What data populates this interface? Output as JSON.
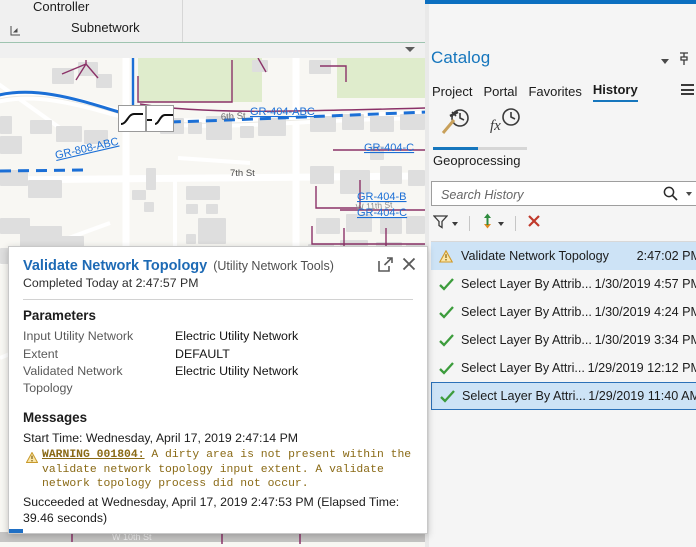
{
  "ribbon": {
    "group_labels": [
      "Controller",
      "Subnetwork"
    ],
    "dialog_launcher_icon": "dialog-launcher-icon"
  },
  "map": {
    "collapse_icon": "chevron-down-icon",
    "street_labels": [
      "6th St",
      "7th St",
      "W 10th St"
    ],
    "feature_labels": [
      "GR-808-ABC",
      "GR-404-ABC",
      "GR-404-C",
      "GR-404-B",
      "GR-404-C"
    ],
    "colors": {
      "land": "#f8f7f3",
      "park": "#dfeccc",
      "building": "#dedede",
      "road": "#ffffff",
      "utility_blue": "#1b6fd6",
      "utility_purple": "#8b3268"
    }
  },
  "result_panel": {
    "title": "Validate Network Topology",
    "toolset": "(Utility Network Tools)",
    "status": "Completed Today at 2:47:57 PM",
    "open_icon": "open-external-icon",
    "close_icon": "close-icon",
    "parameters_heading": "Parameters",
    "parameters": [
      {
        "key": "Input Utility Network",
        "value": "Electric Utility Network"
      },
      {
        "key": "Extent",
        "value": "DEFAULT"
      },
      {
        "key": "Validated Network Topology",
        "value": "Electric Utility Network"
      }
    ],
    "messages_heading": "Messages",
    "start_time": "Start Time: Wednesday, April 17, 2019 2:47:14 PM",
    "warning_icon": "warning-triangle-icon",
    "warning_code": "WARNING 001804:",
    "warning_text": " A dirty area is not present within the validate network topology input extent. A validate network topology process did not occur.",
    "succeeded": "Succeeded at Wednesday, April 17, 2019 2:47:53 PM (Elapsed Time: 39.46 seconds)"
  },
  "catalog": {
    "title": "Catalog",
    "collapse_icon": "chevron-down-icon",
    "pin_icon": "pin-icon",
    "menu_icon": "hamburger-menu-icon",
    "tabs": [
      {
        "label": "Project",
        "active": false
      },
      {
        "label": "Portal",
        "active": false
      },
      {
        "label": "Favorites",
        "active": false
      },
      {
        "label": "History",
        "active": true
      }
    ],
    "history_icons": [
      {
        "name": "geoprocessing-history-icon",
        "active": true
      },
      {
        "name": "function-history-icon",
        "active": false
      }
    ],
    "section_label": "Geoprocessing",
    "search": {
      "placeholder": "Search History",
      "value": "",
      "icon": "search-icon",
      "caret_icon": "chevron-down-icon"
    },
    "toolbar": [
      {
        "name": "filter-icon",
        "has_caret": true
      },
      {
        "name": "sort-icon",
        "has_caret": true
      },
      {
        "name": "delete-icon",
        "has_caret": false
      }
    ],
    "history_items": [
      {
        "status": "warning",
        "name": "Validate Network Topology",
        "time": "2:47:02 PM",
        "highlighted": true,
        "selected": false
      },
      {
        "status": "success",
        "name": "Select Layer By Attrib...",
        "time": "1/30/2019 4:57 PM",
        "highlighted": false,
        "selected": false
      },
      {
        "status": "success",
        "name": "Select Layer By Attrib...",
        "time": "1/30/2019 4:24 PM",
        "highlighted": false,
        "selected": false
      },
      {
        "status": "success",
        "name": "Select Layer By Attrib...",
        "time": "1/30/2019 3:34 PM",
        "highlighted": false,
        "selected": false
      },
      {
        "status": "success",
        "name": "Select Layer By Attri...",
        "time": "1/29/2019 12:12 PM",
        "highlighted": false,
        "selected": false
      },
      {
        "status": "success",
        "name": "Select Layer By Attri...",
        "time": "1/29/2019 11:40 AM",
        "highlighted": false,
        "selected": true
      }
    ]
  }
}
